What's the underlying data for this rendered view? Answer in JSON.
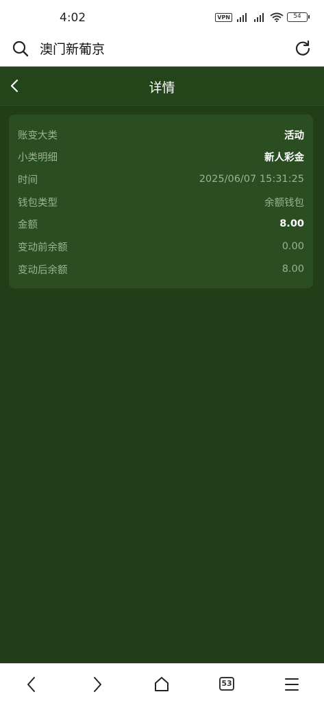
{
  "status_bar": {
    "time": "4:02",
    "vpn": "VPN",
    "battery": "54"
  },
  "browser": {
    "title": "澳门新葡京",
    "tab_count": "53"
  },
  "page": {
    "title": "详情"
  },
  "details": [
    {
      "label": "账变大类",
      "value": "活动",
      "emphasis": true
    },
    {
      "label": "小类明细",
      "value": "新人彩金",
      "emphasis": true
    },
    {
      "label": "时间",
      "value": "2025/06/07 15:31:25",
      "emphasis": false
    },
    {
      "label": "钱包类型",
      "value": "余额钱包",
      "emphasis": false
    },
    {
      "label": "金额",
      "value": "8.00",
      "emphasis": true
    },
    {
      "label": "变动前余额",
      "value": "0.00",
      "emphasis": false
    },
    {
      "label": "变动后余额",
      "value": "8.00",
      "emphasis": false
    }
  ],
  "colors": {
    "background": "#213e18",
    "card": "#2a4e22",
    "muted_text": "#9bb391"
  }
}
